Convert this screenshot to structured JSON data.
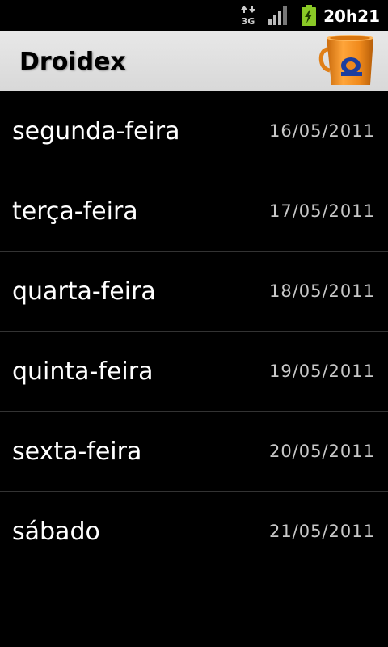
{
  "status_bar": {
    "network_label": "3G",
    "clock": "20h21",
    "icons": [
      "3g-data-icon",
      "signal-strength-icon",
      "battery-charging-icon"
    ]
  },
  "header": {
    "title": "Droidex",
    "logo": "mug-logo-icon"
  },
  "days": [
    {
      "name": "segunda-feira",
      "date": "16/05/2011"
    },
    {
      "name": "terça-feira",
      "date": "17/05/2011"
    },
    {
      "name": "quarta-feira",
      "date": "18/05/2011"
    },
    {
      "name": "quinta-feira",
      "date": "19/05/2011"
    },
    {
      "name": "sexta-feira",
      "date": "20/05/2011"
    },
    {
      "name": "sábado",
      "date": "21/05/2011"
    }
  ],
  "colors": {
    "background": "#000000",
    "title_bar": "#dcdcdc",
    "battery_green": "#8ac926",
    "mug_orange": "#f08a1c",
    "date_text": "#c8c8c8"
  }
}
